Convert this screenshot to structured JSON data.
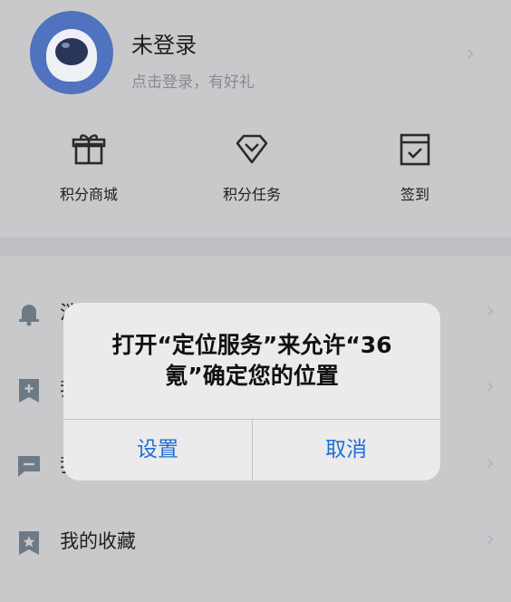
{
  "profile": {
    "name": "未登录",
    "subtitle": "点击登录，有好礼"
  },
  "shortcuts": [
    {
      "label": "积分商城",
      "icon": "gift-icon"
    },
    {
      "label": "积分任务",
      "icon": "diamond-icon"
    },
    {
      "label": "签到",
      "icon": "calendar-check-icon"
    }
  ],
  "menu": [
    {
      "label": "消",
      "icon": "bell-icon"
    },
    {
      "label": "我",
      "icon": "bookmark-plus-icon"
    },
    {
      "label": "我",
      "icon": "message-icon"
    },
    {
      "label": "我的收藏",
      "icon": "star-bookmark-icon"
    }
  ],
  "alert": {
    "line1": "打开“定位服务”来允许“36",
    "line2": "氪”确定您的位置",
    "left_button": "设置",
    "right_button": "取消"
  },
  "colors": {
    "accent": "#1f6fd6",
    "background": "#c9c9cc",
    "dialog": "#ebebec"
  }
}
